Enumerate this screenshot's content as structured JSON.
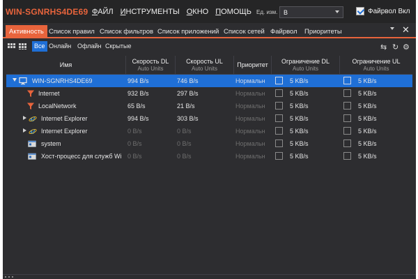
{
  "app": {
    "title": "WIN-SGNRHS4DE69"
  },
  "menu": [
    {
      "pre": "",
      "ul": "Ф",
      "post": "АЙЛ"
    },
    {
      "pre": "",
      "ul": "И",
      "post": "НСТРУМЕНТЫ"
    },
    {
      "pre": "",
      "ul": "О",
      "post": "КНО"
    },
    {
      "pre": "",
      "ul": "П",
      "post": "ОМОЩЬ"
    }
  ],
  "units": {
    "label": "Ед. изм.",
    "value": "B"
  },
  "firewall": {
    "label": "Файрвол Вкл",
    "checked": true
  },
  "tabs": [
    "Активность",
    "Список правил",
    "Список фильтров",
    "Список приложений",
    "Список сетей",
    "Файрвол",
    "Приоритеты"
  ],
  "active_tab": 0,
  "filters": [
    "Все",
    "Онлайн",
    "Офлайн",
    "Скрытые"
  ],
  "active_filter": 0,
  "columns": {
    "name": "Имя",
    "dl": {
      "title": "Скорость DL",
      "sub": "Auto Units"
    },
    "ul": {
      "title": "Скорость UL",
      "sub": "Auto Units"
    },
    "priority": "Приоритет",
    "limit_dl": {
      "title": "Ограничение DL",
      "sub": "Auto Units"
    },
    "limit_ul": {
      "title": "Ограничение UL",
      "sub": "Auto Units"
    }
  },
  "rows": [
    {
      "name": "WIN-SGNRHS4DE69",
      "icon": "computer-icon",
      "expander": "open",
      "dl": "994 B/s",
      "ul": "746 B/s",
      "priority": "Нормальн",
      "limit_dl": "5 KB/s",
      "limit_ul": "5 KB/s",
      "selected": true,
      "dim": false
    },
    {
      "name": "Internet",
      "icon": "funnel-icon",
      "expander": "",
      "dl": "932 B/s",
      "ul": "297 B/s",
      "priority": "Нормальн",
      "limit_dl": "5 KB/s",
      "limit_ul": "5 KB/s",
      "selected": false,
      "dim": false
    },
    {
      "name": "LocalNetwork",
      "icon": "funnel-icon",
      "expander": "",
      "dl": "65 B/s",
      "ul": "21 B/s",
      "priority": "Нормальн",
      "limit_dl": "5 KB/s",
      "limit_ul": "5 KB/s",
      "selected": false,
      "dim": false
    },
    {
      "name": "Internet Explorer",
      "icon": "ie-icon",
      "expander": "closed",
      "dl": "994 B/s",
      "ul": "303 B/s",
      "priority": "Нормальн",
      "limit_dl": "5 KB/s",
      "limit_ul": "5 KB/s",
      "selected": false,
      "dim": false
    },
    {
      "name": "Internet Explorer",
      "icon": "ie-icon",
      "expander": "closed",
      "dl": "0 B/s",
      "ul": "0 B/s",
      "priority": "Нормальн",
      "limit_dl": "5 KB/s",
      "limit_ul": "5 KB/s",
      "selected": false,
      "dim": true
    },
    {
      "name": "system",
      "icon": "app-window-icon",
      "expander": "",
      "dl": "0 B/s",
      "ul": "0 B/s",
      "priority": "Нормальн",
      "limit_dl": "5 KB/s",
      "limit_ul": "5 KB/s",
      "selected": false,
      "dim": true
    },
    {
      "name": "Хост-процесс для служб Wi",
      "icon": "app-window-icon",
      "expander": "",
      "dl": "0 B/s",
      "ul": "0 B/s",
      "priority": "Нормальн",
      "limit_dl": "5 KB/s",
      "limit_ul": "5 KB/s",
      "selected": false,
      "dim": true
    }
  ],
  "colors": {
    "accent": "#e8643c",
    "selection": "#1f6fd6",
    "background": "#2d2d30"
  }
}
